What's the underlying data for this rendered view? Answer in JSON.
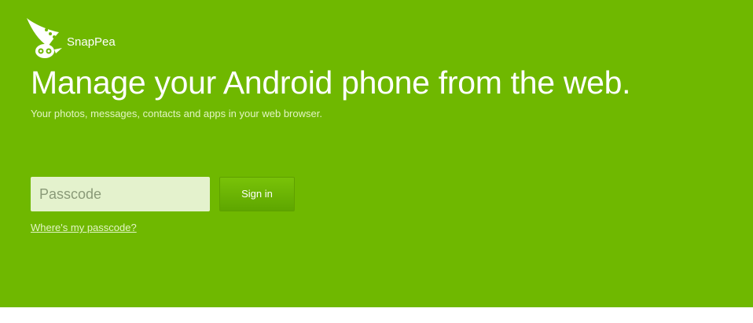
{
  "header": {
    "brand_name": "SnapPea",
    "logo_icon": "snappea-logo-icon"
  },
  "hero": {
    "headline": "Manage your Android phone from the web.",
    "subtitle": "Your photos, messages, contacts and apps in your web browser.",
    "background_color": "#6fb800"
  },
  "signin": {
    "passcode_placeholder": "Passcode",
    "passcode_value": "",
    "button_label": "Sign in",
    "help_link": "Where's my passcode?"
  }
}
